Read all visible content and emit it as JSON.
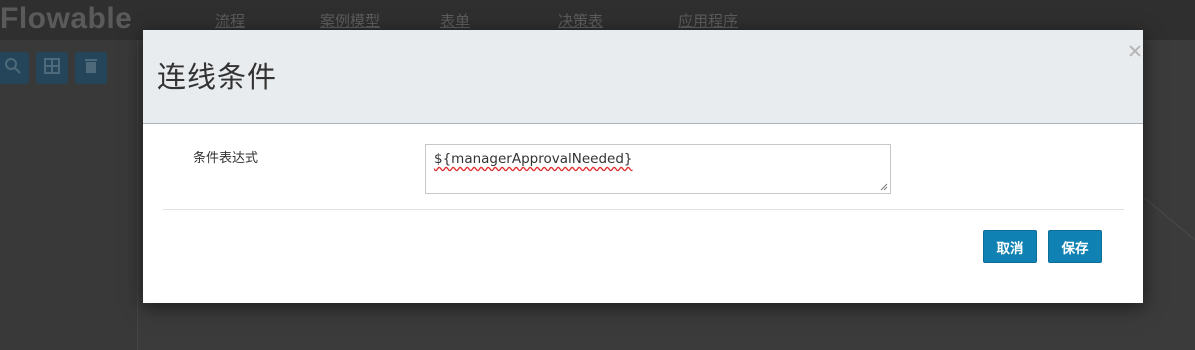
{
  "background": {
    "logo_text": "Flowable",
    "nav_items": [
      "流程",
      "案例模型",
      "表单",
      "决策表",
      "应用程序"
    ]
  },
  "dialog": {
    "title": "连线条件",
    "close_glyph": "×",
    "field_label": "条件表达式",
    "condition_expression_value": "${managerApprovalNeeded}",
    "cancel_label": "取消",
    "save_label": "保存"
  },
  "colors": {
    "primary_button": "#0f82b3",
    "header_bg": "#e8ecef",
    "overlay": "#3a3a3a"
  },
  "icons": [
    "search-icon",
    "grid-icon",
    "trash-icon",
    "close-icon"
  ]
}
